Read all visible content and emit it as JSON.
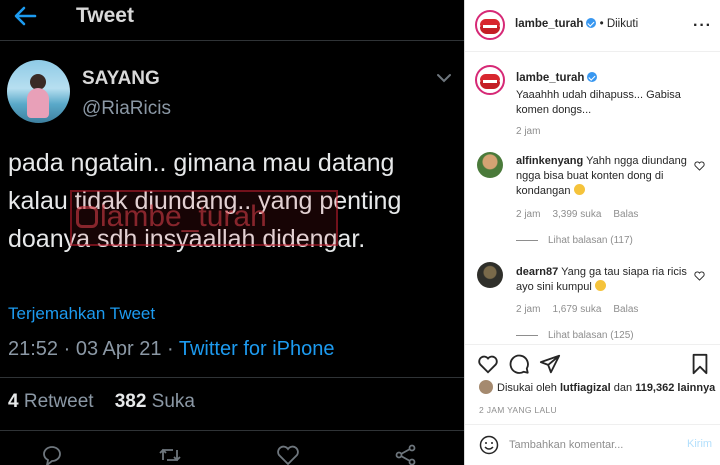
{
  "tweet": {
    "header_title": "Tweet",
    "name": "SAYANG",
    "handle": "@RiaRicis",
    "text": "pada ngatain.. gimana mau datang kalau tidak diundang.. yang penting doanya sdh insyaallah didengar.",
    "watermark": "lambe_turah",
    "translate_label": "Terjemahkan Tweet",
    "timestamp": "21:52 · 03 Apr 21 · ",
    "source": "Twitter for iPhone",
    "retweet_count": "4",
    "retweet_label": "Retweet",
    "like_count": "382",
    "like_label": "Suka",
    "colors": {
      "background": "#000000",
      "link": "#1d9bf0",
      "muted": "#8b98a5"
    }
  },
  "instagram": {
    "header": {
      "username": "lambe_turah",
      "separator": " • ",
      "follow_status": "Diikuti",
      "more": "···"
    },
    "caption": {
      "username": "lambe_turah",
      "text": "Yaaahhh udah dihapuss... Gabisa komen dongs...",
      "time": "2 jam"
    },
    "comments": [
      {
        "username": "alfinkenyang",
        "text": "Yahh ngga diundang ngga bisa buat konten dong di kondangan",
        "time": "2 jam",
        "likes": "3,399 suka",
        "reply": "Balas",
        "view_replies": "Lihat balasan (117)"
      },
      {
        "username": "dearn87",
        "text": "Yang ga tau siapa ria ricis ayo sini kumpul",
        "time": "2 jam",
        "likes": "1,679 suka",
        "reply": "Balas",
        "view_replies": "Lihat balasan (125)"
      }
    ],
    "liked_by": {
      "prefix": "Disukai oleh ",
      "user": "lutfiagizal",
      "middle": " dan ",
      "count": "119,362 lainnya"
    },
    "date": "2 JAM YANG LALU",
    "comment_placeholder": "Tambahkan komentar...",
    "post_label": "Kirim",
    "colors": {
      "verified": "#3897f0",
      "muted": "#8e8e8e",
      "post_disabled": "#b2dffc",
      "story_ring": "#d62976"
    }
  }
}
